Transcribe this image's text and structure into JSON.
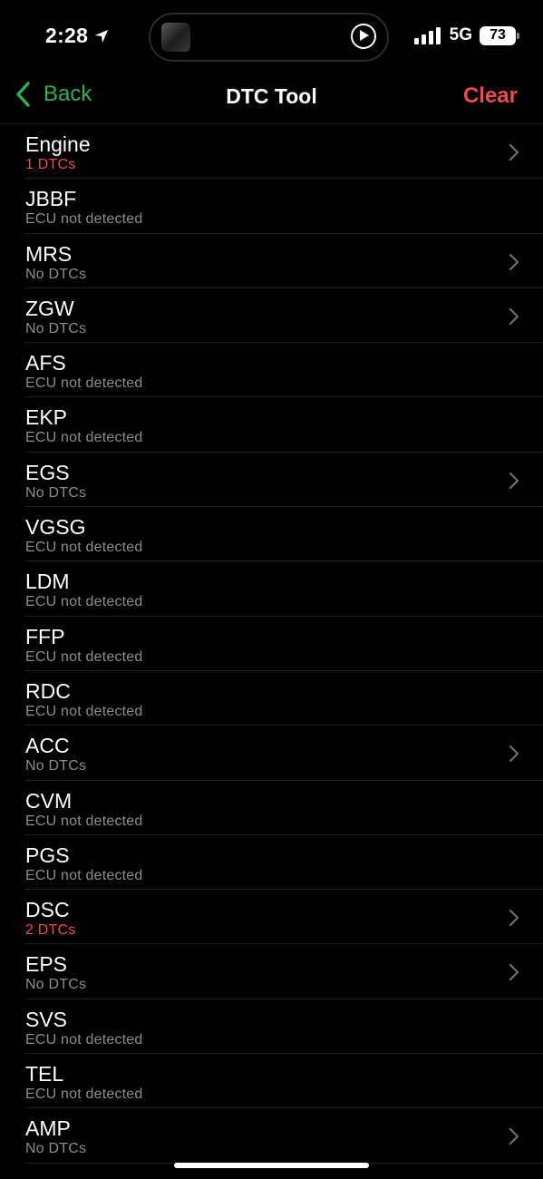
{
  "status_bar": {
    "time": "2:28",
    "network": "5G",
    "battery": "73"
  },
  "nav": {
    "back_label": "Back",
    "title": "DTC Tool",
    "clear_label": "Clear"
  },
  "colors": {
    "accent_green": "#30b050",
    "alert_red": "#ee4b4b",
    "secondary_text": "#8c8c8c"
  },
  "modules": [
    {
      "name": "Engine",
      "status": "1 DTCs",
      "alert": true,
      "chevron": true
    },
    {
      "name": "JBBF",
      "status": "ECU not detected",
      "alert": false,
      "chevron": false
    },
    {
      "name": "MRS",
      "status": "No DTCs",
      "alert": false,
      "chevron": true
    },
    {
      "name": "ZGW",
      "status": "No DTCs",
      "alert": false,
      "chevron": true
    },
    {
      "name": "AFS",
      "status": "ECU not detected",
      "alert": false,
      "chevron": false
    },
    {
      "name": "EKP",
      "status": "ECU not detected",
      "alert": false,
      "chevron": false
    },
    {
      "name": "EGS",
      "status": "No DTCs",
      "alert": false,
      "chevron": true
    },
    {
      "name": "VGSG",
      "status": "ECU not detected",
      "alert": false,
      "chevron": false
    },
    {
      "name": "LDM",
      "status": "ECU not detected",
      "alert": false,
      "chevron": false
    },
    {
      "name": "FFP",
      "status": "ECU not detected",
      "alert": false,
      "chevron": false
    },
    {
      "name": "RDC",
      "status": "ECU not detected",
      "alert": false,
      "chevron": false
    },
    {
      "name": "ACC",
      "status": "No DTCs",
      "alert": false,
      "chevron": true
    },
    {
      "name": "CVM",
      "status": "ECU not detected",
      "alert": false,
      "chevron": false
    },
    {
      "name": "PGS",
      "status": "ECU not detected",
      "alert": false,
      "chevron": false
    },
    {
      "name": "DSC",
      "status": "2 DTCs",
      "alert": true,
      "chevron": true
    },
    {
      "name": "EPS",
      "status": "No DTCs",
      "alert": false,
      "chevron": true
    },
    {
      "name": "SVS",
      "status": "ECU not detected",
      "alert": false,
      "chevron": false
    },
    {
      "name": "TEL",
      "status": "ECU not detected",
      "alert": false,
      "chevron": false
    },
    {
      "name": "AMP",
      "status": "No DTCs",
      "alert": false,
      "chevron": true
    }
  ]
}
